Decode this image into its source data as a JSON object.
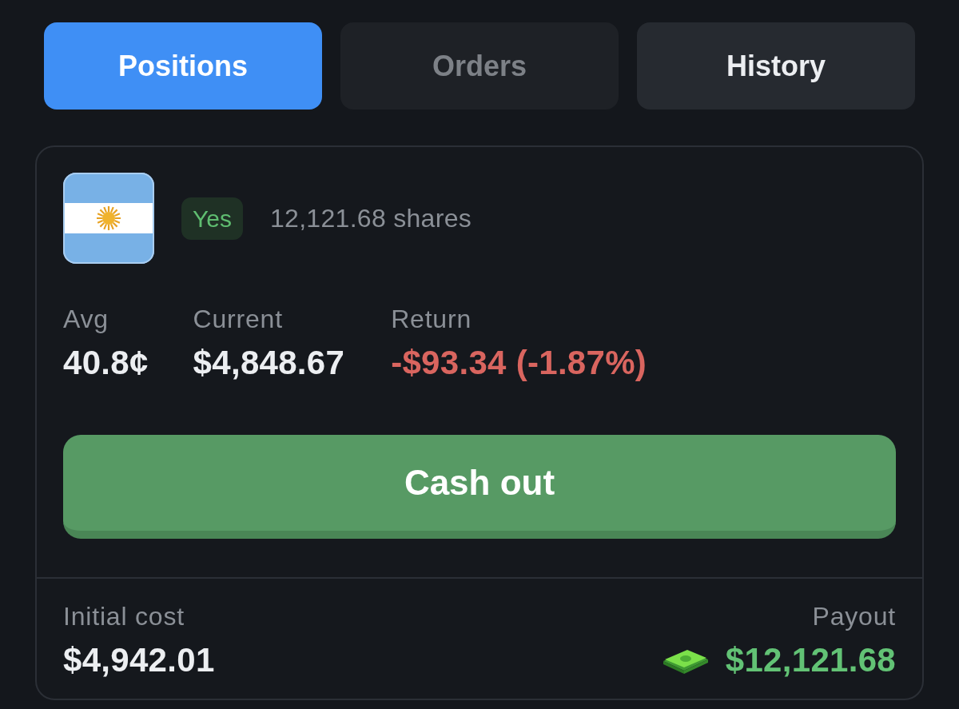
{
  "tabs": [
    {
      "label": "Positions",
      "selected": true,
      "disabled": false
    },
    {
      "label": "Orders",
      "selected": false,
      "disabled": true
    },
    {
      "label": "History",
      "selected": false,
      "disabled": false
    }
  ],
  "position": {
    "outcome_badge": "Yes",
    "shares": "12,121.68 shares",
    "stats": [
      {
        "label": "Avg",
        "value": "40.8¢",
        "kind": "neutral"
      },
      {
        "label": "Current",
        "value": "$4,848.67",
        "kind": "neutral"
      },
      {
        "label": "Return",
        "value": "-$93.34 (-1.87%)",
        "kind": "loss"
      }
    ],
    "cash_out_button": "Cash out",
    "initial_cost": {
      "label": "Initial cost",
      "value": "$4,942.01"
    },
    "payout": {
      "label": "Payout",
      "value": "$12,121.68"
    }
  }
}
